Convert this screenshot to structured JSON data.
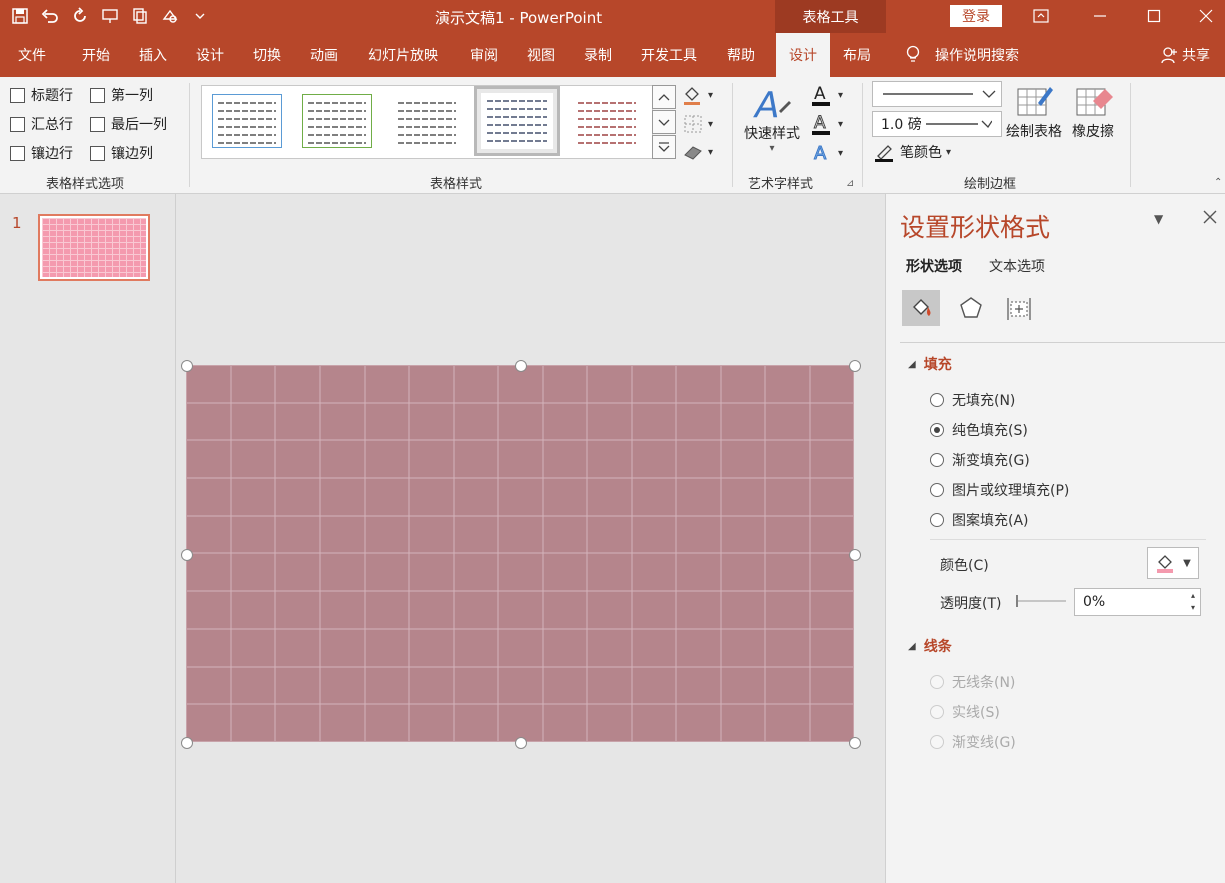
{
  "titlebar": {
    "doc_title": "演示文稿1  -  PowerPoint",
    "context_tools": "表格工具",
    "login": "登录",
    "accent": "#b7472a"
  },
  "tabs": [
    "文件",
    "开始",
    "插入",
    "设计",
    "切换",
    "动画",
    "幻灯片放映",
    "审阅",
    "视图",
    "录制",
    "开发工具",
    "帮助",
    "设计",
    "布局"
  ],
  "tell_me": "操作说明搜索",
  "share": "共享",
  "ribbon": {
    "style_options": {
      "items": [
        "标题行",
        "第一列",
        "汇总行",
        "最后一列",
        "镶边行",
        "镶边列"
      ],
      "label": "表格样式选项"
    },
    "table_styles": {
      "label": "表格样式"
    },
    "wordart": {
      "quick_styles": "快速样式",
      "label": "艺术字样式"
    },
    "draw_borders": {
      "weight": "1.0 磅",
      "pen_color": "笔颜色",
      "draw_table": "绘制表格",
      "eraser": "橡皮擦",
      "label": "绘制边框"
    }
  },
  "slides": {
    "number": "1"
  },
  "format_pane": {
    "title": "设置形状格式",
    "tabs": [
      "形状选项",
      "文本选项"
    ],
    "fill": {
      "title": "填充",
      "options": [
        "无填充(N)",
        "纯色填充(S)",
        "渐变填充(G)",
        "图片或纹理填充(P)",
        "图案填充(A)"
      ],
      "color_label": "颜色(C)",
      "transparency_label": "透明度(T)",
      "transparency_value": "0%"
    },
    "line": {
      "title": "线条",
      "options": [
        "无线条(N)",
        "实线(S)",
        "渐变线(G)"
      ]
    }
  }
}
